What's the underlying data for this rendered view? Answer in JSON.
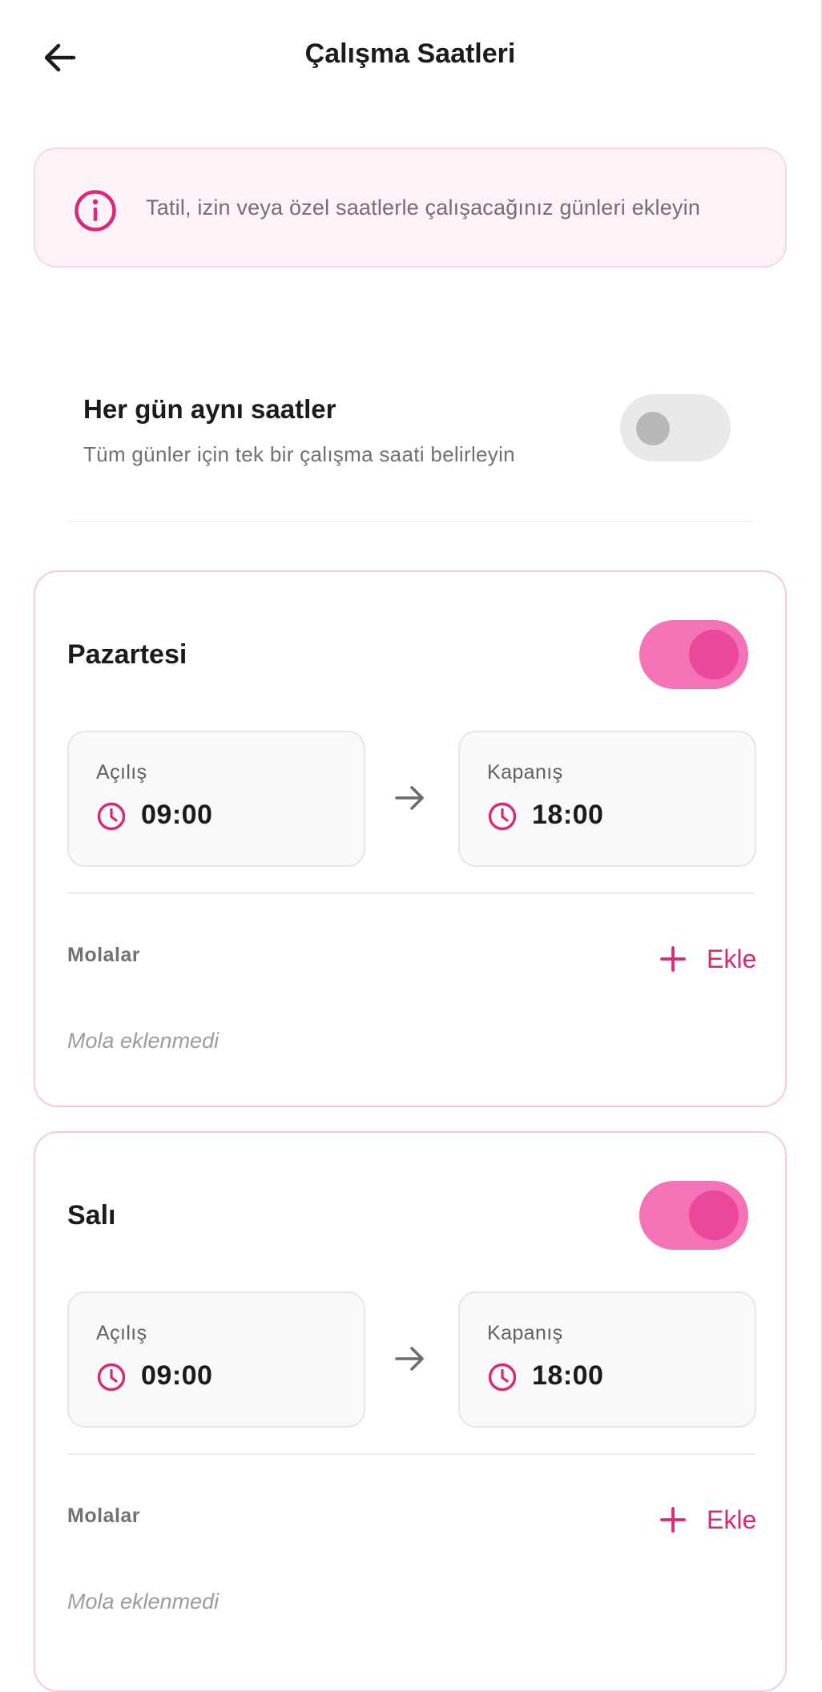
{
  "header": {
    "title": "Çalışma Saatleri"
  },
  "info_banner": {
    "text": "Tatil, izin veya özel saatlerle çalışacağınız günleri ekleyin"
  },
  "same_hours": {
    "title": "Her gün aynı saatler",
    "subtitle": "Tüm günler için tek bir çalışma saati belirleyin",
    "enabled": false
  },
  "days": [
    {
      "name": "Pazartesi",
      "enabled": true,
      "open_label": "Açılış",
      "open_time": "09:00",
      "close_label": "Kapanış",
      "close_time": "18:00",
      "breaks_label": "Molalar",
      "add_label": "Ekle",
      "empty_text": "Mola eklenmedi"
    },
    {
      "name": "Salı",
      "enabled": true,
      "open_label": "Açılış",
      "open_time": "09:00",
      "close_label": "Kapanış",
      "close_time": "18:00",
      "breaks_label": "Molalar",
      "add_label": "Ekle",
      "empty_text": "Mola eklenmedi"
    }
  ],
  "colors": {
    "accent": "#ec4899",
    "accent_light": "#f472b6",
    "accent_text": "#db2777",
    "banner_bg": "#fdf2f8",
    "card_border": "#f6c9e3"
  },
  "icons": [
    "back-arrow-icon",
    "info-icon",
    "clock-icon",
    "arrow-right-icon",
    "plus-icon"
  ]
}
